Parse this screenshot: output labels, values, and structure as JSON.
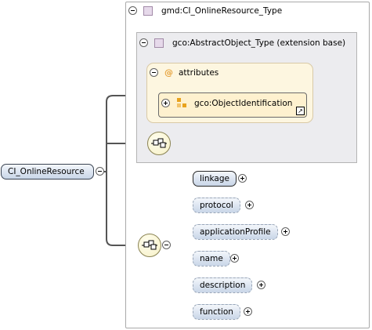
{
  "root": {
    "label": "CI_OnlineResource"
  },
  "type_box": {
    "title": "gmd:CI_OnlineResource_Type"
  },
  "extension": {
    "title": "gco:AbstractObject_Type (extension base)"
  },
  "attributes": {
    "title": "attributes",
    "icon": "at-sign-icon",
    "item": "gco:ObjectIdentification"
  },
  "sequence": {
    "elements": [
      {
        "label": "linkage",
        "optional": false
      },
      {
        "label": "protocol",
        "optional": true
      },
      {
        "label": "applicationProfile",
        "optional": true
      },
      {
        "label": "name",
        "optional": true
      },
      {
        "label": "description",
        "optional": true
      },
      {
        "label": "function",
        "optional": true
      }
    ]
  },
  "colors": {
    "element_fill": "#d4dfee",
    "attribute_fill": "#fdf6e0",
    "sequence_fill": "#f6f0c4",
    "extension_fill": "#ececef"
  }
}
